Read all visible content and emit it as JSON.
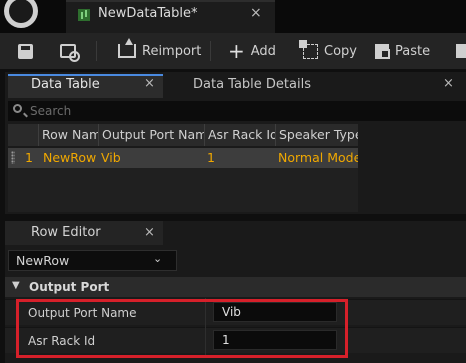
{
  "window": {
    "doc_tab_title": "NewDataTable*",
    "doc_tab_close": "×"
  },
  "toolbar": {
    "reimport": "Reimport",
    "add": "Add",
    "copy": "Copy",
    "paste": "Paste"
  },
  "tabs": {
    "data_table": "Data Table",
    "data_table_details": "Data Table Details",
    "close": "×"
  },
  "search": {
    "placeholder": "Search"
  },
  "table": {
    "headers": [
      "Row Nam",
      "Output Port Name",
      "Asr Rack Id",
      "Speaker Type"
    ],
    "rows": [
      {
        "index": "1",
        "row_name": "NewRow",
        "output_port_name": "Vib",
        "asr_rack_id": "1",
        "speaker_type": "Normal Mode"
      }
    ]
  },
  "row_editor": {
    "tab": "Row Editor",
    "selected_row": "NewRow",
    "chevron": "⌄",
    "category": "Output Port",
    "properties": [
      {
        "label": "Output Port Name",
        "value": "Vib"
      },
      {
        "label": "Asr Rack Id",
        "value": "1"
      }
    ]
  },
  "colors": {
    "accent": "#4a8ae0",
    "row_text": "#f0a800",
    "highlight": "#d6202a"
  }
}
